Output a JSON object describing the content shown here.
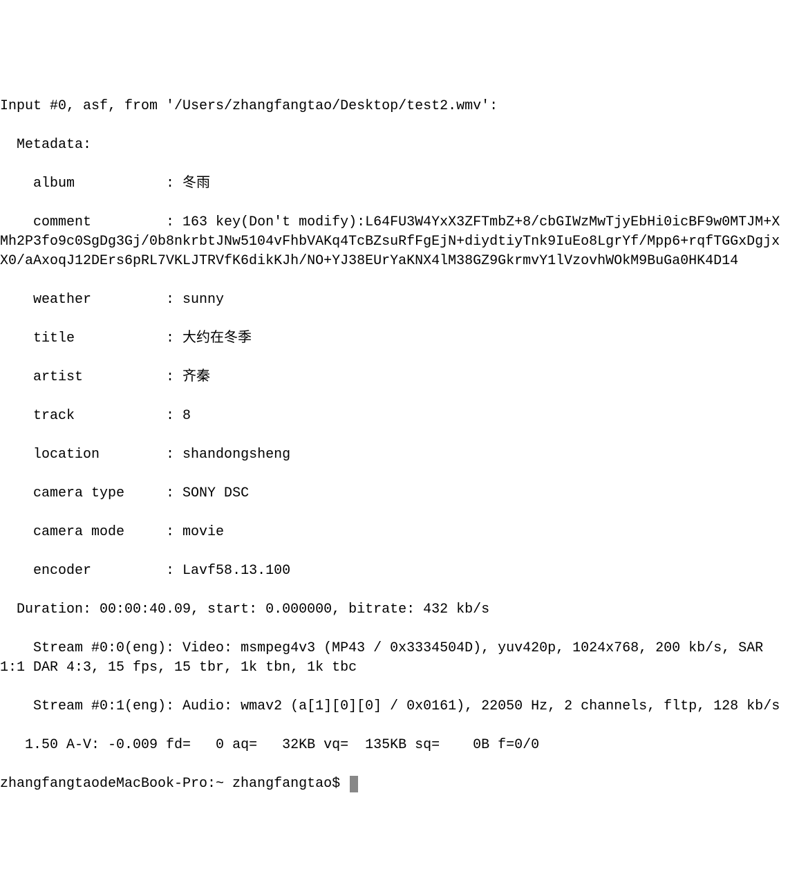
{
  "lines": {
    "input_header": "Input #0, asf, from '/Users/zhangfangtao/Desktop/test2.wmv':",
    "metadata_header": "  Metadata:",
    "album": "    album           : 冬雨",
    "comment_wrap": "    comment         : 163 key(Don't modify):L64FU3W4YxX3ZFTmbZ+8/cbGIWzMwTjyEbHi0icBF9w0MTJM+XMh2P3fo9c0SgDg3Gj/0b8nkrbtJNw5104vFhbVAKq4TcBZsuRfFgEjN+diydtiyTnk9IuEo8LgrYf/Mpp6+rqfTGGxDgjxX0/aAxoqJ12DErs6pRL7VKLJTRVfK6dikKJh/NO+YJ38EUrYaKNX4lM38GZ9GkrmvY1lVzovhWOkM9BuGa0HK4D14",
    "weather": "    weather         : sunny",
    "title": "    title           : 大约在冬季",
    "artist": "    artist          : 齐秦",
    "track": "    track           : 8",
    "location": "    location        : shandongsheng",
    "camera_type": "    camera type     : SONY DSC",
    "camera_mode": "    camera mode     : movie",
    "encoder": "    encoder         : Lavf58.13.100",
    "duration": "  Duration: 00:00:40.09, start: 0.000000, bitrate: 432 kb/s",
    "stream0": "    Stream #0:0(eng): Video: msmpeg4v3 (MP43 / 0x3334504D), yuv420p, 1024x768, 200 kb/s, SAR 1:1 DAR 4:3, 15 fps, 15 tbr, 1k tbn, 1k tbc",
    "stream1": "    Stream #0:1(eng): Audio: wmav2 (a[1][0][0] / 0x0161), 22050 Hz, 2 channels, fltp, 128 kb/s",
    "stats": "   1.50 A-V: -0.009 fd=   0 aq=   32KB vq=  135KB sq=    0B f=0/0",
    "prompt": "zhangfangtaodeMacBook-Pro:~ zhangfangtao$ "
  }
}
